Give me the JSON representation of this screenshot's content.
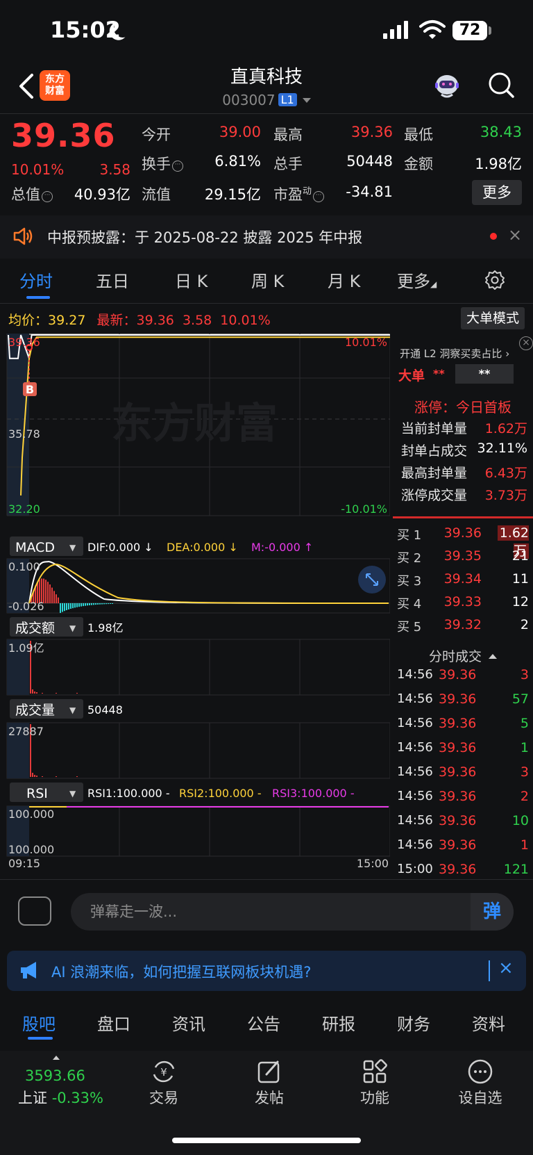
{
  "status_bar": {
    "time": "15:02",
    "battery": "72"
  },
  "header": {
    "logo_line1": "东方",
    "logo_line2": "财富",
    "stock_name": "直真科技",
    "stock_code": "003007",
    "level_badge": "L1"
  },
  "quote": {
    "price": "39.36",
    "change_pct": "10.01%",
    "change_amt": "3.58",
    "open_label": "今开",
    "open": "39.00",
    "high_label": "最高",
    "high": "39.36",
    "low_label": "最低",
    "low": "38.43",
    "turnover_label": "换手",
    "turnover": "6.81%",
    "volume_label": "总手",
    "volume": "50448",
    "amount_label": "金额",
    "amount": "1.98亿",
    "mktcap_label": "总值",
    "mktcap": "40.93亿",
    "float_label": "流值",
    "float": "29.15亿",
    "pe_label": "市盈",
    "pe_sup": "动",
    "pe": "-34.81",
    "more_button": "更多"
  },
  "notice": {
    "text": "中报预披露：于 2025-08-22 披露 2025 年中报",
    "close": "×"
  },
  "tabs": [
    "分时",
    "五日",
    "日 K",
    "周 K",
    "月 K",
    "更多"
  ],
  "chart_info": {
    "avg_label": "均价：",
    "avg": "39.27",
    "last_label": "最新：",
    "last": "39.36",
    "last_chg": "3.58",
    "last_pct": "10.01%",
    "big_mode": "大单模式"
  },
  "chart_data": [
    {
      "type": "line",
      "title": "分时",
      "y_labels": {
        "top": "39.36",
        "mid": "35.78",
        "bottom": "32.20",
        "top_pct": "10.01%",
        "bottom_pct": "-10.01%"
      },
      "x_labels": [
        "09:15",
        "15:00"
      ],
      "ylim": [
        32.2,
        39.36
      ],
      "series": [
        {
          "name": "price",
          "color": "#ffffff",
          "x": [
            "09:30",
            "09:31",
            "09:32",
            "09:33",
            "15:00"
          ],
          "values": [
            38.43,
            39.36,
            39.36,
            39.36,
            39.36
          ]
        },
        {
          "name": "avg",
          "color": "#ffd23a",
          "x": [
            "09:30",
            "09:31",
            "09:33",
            "15:00"
          ],
          "values": [
            38.43,
            39.0,
            39.27,
            39.27
          ]
        }
      ],
      "marker": "B"
    },
    {
      "type": "line",
      "title": "MACD",
      "selector": "MACD",
      "dif_label": "DIF:0.000 ↓",
      "dea_label": "DEA:0.000 ↓",
      "m_label": "M:-0.000 ↑",
      "y_labels": {
        "top": "0.100",
        "bottom": "-0.026"
      },
      "ylim": [
        -0.026,
        0.1
      ]
    },
    {
      "type": "bar",
      "title": "成交额",
      "selector": "成交额",
      "value": "1.98亿",
      "y_labels": {
        "top": "1.09亿"
      }
    },
    {
      "type": "bar",
      "title": "成交量",
      "selector": "成交量",
      "value": "50448",
      "y_labels": {
        "top": "27887"
      }
    },
    {
      "type": "line",
      "title": "RSI",
      "selector": "RSI",
      "rsi1": "RSI1:100.000 -",
      "rsi2": "RSI2:100.000 -",
      "rsi3": "RSI3:100.000 -",
      "y_labels": {
        "top": "100.000",
        "bottom": "100.000"
      }
    }
  ],
  "watermark": "东方财富",
  "l2_panel": {
    "title": "开通 L2 洞察买卖占比 ›",
    "big_order_label": "大单",
    "stars1": "**",
    "stars2": "**",
    "limit_title": "涨停：今日首板",
    "limit_rows": [
      {
        "label": "当前封单量",
        "value": "1.62万",
        "color": "#ff3b3b"
      },
      {
        "label": "封单占成交",
        "value": "32.11%",
        "color": "#ffffff"
      },
      {
        "label": "最高封单量",
        "value": "6.43万",
        "color": "#ff3b3b"
      },
      {
        "label": "涨停成交量",
        "value": "3.73万",
        "color": "#ff3b3b"
      }
    ]
  },
  "order_book": [
    {
      "label": "买 1",
      "price": "39.36",
      "vol": "1.62万"
    },
    {
      "label": "买 2",
      "price": "39.35",
      "vol": "21"
    },
    {
      "label": "买 3",
      "price": "39.34",
      "vol": "11"
    },
    {
      "label": "买 4",
      "price": "39.33",
      "vol": "12"
    },
    {
      "label": "买 5",
      "price": "39.32",
      "vol": "2"
    }
  ],
  "ticks_title": "分时成交",
  "ticks": [
    {
      "time": "14:56",
      "price": "39.36",
      "vol": "3",
      "color": "#ff3b3b"
    },
    {
      "time": "14:56",
      "price": "39.36",
      "vol": "57",
      "color": "#2fd14d"
    },
    {
      "time": "14:56",
      "price": "39.36",
      "vol": "5",
      "color": "#2fd14d"
    },
    {
      "time": "14:56",
      "price": "39.36",
      "vol": "1",
      "color": "#2fd14d"
    },
    {
      "time": "14:56",
      "price": "39.36",
      "vol": "3",
      "color": "#ff3b3b"
    },
    {
      "time": "14:56",
      "price": "39.36",
      "vol": "2",
      "color": "#ff3b3b"
    },
    {
      "time": "14:56",
      "price": "39.36",
      "vol": "10",
      "color": "#2fd14d"
    },
    {
      "time": "14:56",
      "price": "39.36",
      "vol": "1",
      "color": "#ff3b3b"
    },
    {
      "time": "15:00",
      "price": "39.36",
      "vol": "121",
      "color": "#2fd14d"
    }
  ],
  "comment": {
    "placeholder": "弹幕走一波...",
    "dan": "弹"
  },
  "ai_banner": {
    "text": "AI 浪潮来临，如何把握互联网板块机遇?",
    "close": "×"
  },
  "bottom_tabs": [
    "股吧",
    "盘口",
    "资讯",
    "公告",
    "研报",
    "财务",
    "资料"
  ],
  "footer": {
    "index_value": "3593.66",
    "index_name": "上证",
    "index_change": "-0.33%",
    "nav": [
      "交易",
      "发帖",
      "功能",
      "设自选"
    ]
  }
}
